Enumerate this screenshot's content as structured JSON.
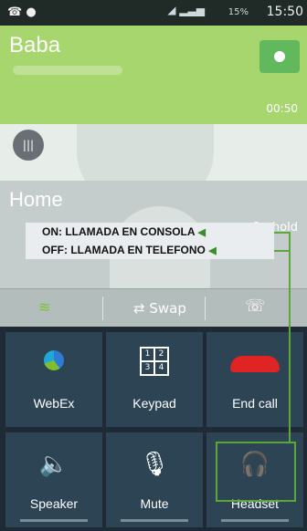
{
  "status_bar": {
    "time": "15:50",
    "battery": "15%",
    "icons": [
      "phone-call-icon",
      "mic-icon",
      "wifi-icon",
      "signal-icon",
      "battery-icon"
    ]
  },
  "active_call": {
    "name": "Baba",
    "timer": "00:50",
    "color": "#a7d66e"
  },
  "held_call": {
    "name": "Home",
    "status": "On hold"
  },
  "annotations": [
    "ON: LLAMADA EN CONSOLA",
    "OFF: LLAMADA EN TELEFONO"
  ],
  "mid_toolbar": {
    "swap_label": "Swap"
  },
  "buttons": {
    "webex": "WebEx",
    "keypad": "Keypad",
    "end_call": "End call",
    "speaker": "Speaker",
    "mute": "Mute",
    "headset": "Headset"
  },
  "accent": {
    "annotation_green": "#5ca73a",
    "end_call_red": "#e02424"
  }
}
